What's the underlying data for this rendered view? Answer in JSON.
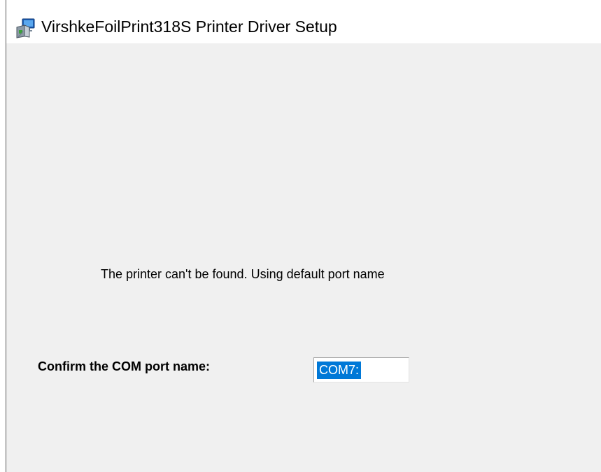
{
  "window": {
    "title": "VirshkeFoilPrint318S Printer Driver Setup",
    "icon": "installer-icon"
  },
  "content": {
    "message": "The printer can't be found. Using default port name",
    "confirm_label": "Confirm the COM port name:",
    "port_value": "COM7:"
  },
  "colors": {
    "client_background": "#f0f0f0",
    "selection_highlight": "#0078d7"
  }
}
